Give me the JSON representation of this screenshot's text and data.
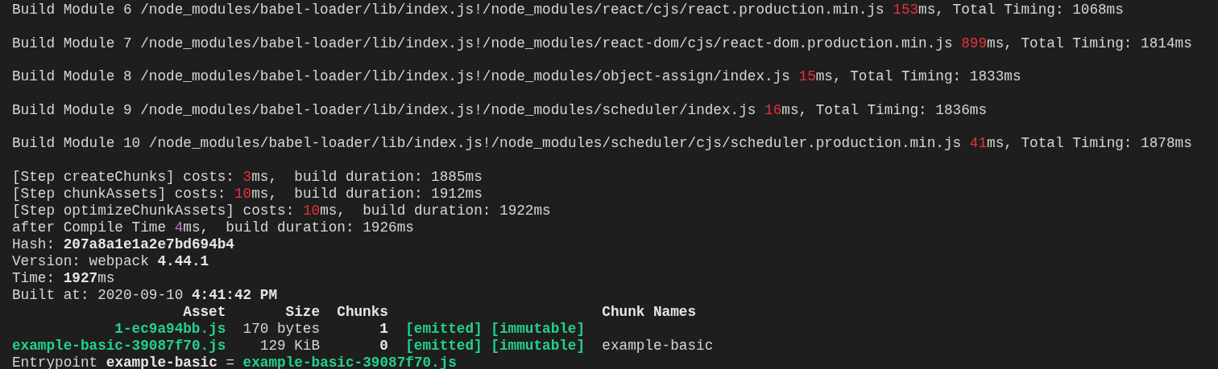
{
  "module_lines": [
    {
      "segments": [
        {
          "text": "Build Module 6 /node_modules/babel-loader/lib/index.js!/node_modules/react/cjs/react.production.min.js ",
          "kind": "text"
        },
        {
          "text": "153",
          "kind": "timing"
        },
        {
          "text": "ms, Total Timing: 1068ms",
          "kind": "text"
        }
      ]
    },
    {
      "segments": [
        {
          "text": "Build Module 7 /node_modules/babel-loader/lib/index.js!/node_modules/react-dom/cjs/react-dom.production.min.js ",
          "kind": "text"
        },
        {
          "text": "899",
          "kind": "timing"
        },
        {
          "text": "ms, Total Timing: 1814ms",
          "kind": "text"
        }
      ]
    },
    {
      "segments": [
        {
          "text": "Build Module 8 /node_modules/babel-loader/lib/index.js!/node_modules/object-assign/index.js ",
          "kind": "text"
        },
        {
          "text": "15",
          "kind": "timing"
        },
        {
          "text": "ms, Total Timing: 1833ms",
          "kind": "text"
        }
      ]
    },
    {
      "segments": [
        {
          "text": "Build Module 9 /node_modules/babel-loader/lib/index.js!/node_modules/scheduler/index.js ",
          "kind": "text"
        },
        {
          "text": "16",
          "kind": "timing"
        },
        {
          "text": "ms, Total Timing: 1836ms",
          "kind": "text"
        }
      ]
    },
    {
      "segments": [
        {
          "text": "Build Module 10 /node_modules/babel-loader/lib/index.js!/node_modules/scheduler/cjs/scheduler.production.min.js ",
          "kind": "text"
        },
        {
          "text": "41",
          "kind": "timing"
        },
        {
          "text": "ms, Total Timing: 1878ms",
          "kind": "text"
        }
      ]
    }
  ],
  "log_lines": [
    {
      "segments": [
        {
          "text": "[Step createChunks] costs: ",
          "kind": "text"
        },
        {
          "text": "3",
          "kind": "timing"
        },
        {
          "text": "ms,  build duration: 1885ms",
          "kind": "text"
        }
      ]
    },
    {
      "segments": [
        {
          "text": "[Step chunkAssets] costs: ",
          "kind": "text"
        },
        {
          "text": "10",
          "kind": "timing"
        },
        {
          "text": "ms,  build duration: 1912ms",
          "kind": "text"
        }
      ]
    },
    {
      "segments": [
        {
          "text": "[Step optimizeChunkAssets] costs: ",
          "kind": "text"
        },
        {
          "text": "10",
          "kind": "timing"
        },
        {
          "text": "ms,  build duration: 1922ms",
          "kind": "text"
        }
      ]
    },
    {
      "segments": [
        {
          "text": "after Compile Time ",
          "kind": "text"
        },
        {
          "text": "4",
          "kind": "compile"
        },
        {
          "text": "ms,  build duration: 1926ms",
          "kind": "text"
        }
      ]
    },
    {
      "segments": [
        {
          "text": "Hash: ",
          "kind": "text"
        },
        {
          "text": "207a8a1e1a2e7bd694b4",
          "kind": "value"
        }
      ]
    },
    {
      "segments": [
        {
          "text": "Version: webpack ",
          "kind": "text"
        },
        {
          "text": "4.44.1",
          "kind": "value"
        }
      ]
    },
    {
      "segments": [
        {
          "text": "Time: ",
          "kind": "text"
        },
        {
          "text": "1927",
          "kind": "value"
        },
        {
          "text": "ms",
          "kind": "text"
        }
      ]
    },
    {
      "segments": [
        {
          "text": "Built at: 2020-09-10 ",
          "kind": "text"
        },
        {
          "text": "4:41:42 PM",
          "kind": "value"
        }
      ]
    }
  ],
  "asset_table": {
    "columns": [
      "Asset",
      "Size",
      "Chunks",
      "Chunk Names"
    ],
    "rows": [
      {
        "asset": "1-ec9a94bb.js",
        "size": "170 bytes",
        "chunks": "1",
        "flags": [
          "[emitted]",
          "[immutable]"
        ]
      },
      {
        "asset": "example-basic-39087f70.js",
        "size": "129 KiB",
        "chunks": "0",
        "flags": [
          "[emitted]",
          "[immutable]"
        ],
        "chunk_names": "example-basic"
      }
    ]
  },
  "tail_lines": [
    {
      "segments": [
        {
          "text": "Entrypoint ",
          "kind": "text"
        },
        {
          "text": "example-basic",
          "kind": "value"
        },
        {
          "text": " = ",
          "kind": "text"
        },
        {
          "text": "example-basic-39087f70.js",
          "kind": "file"
        }
      ]
    }
  ]
}
